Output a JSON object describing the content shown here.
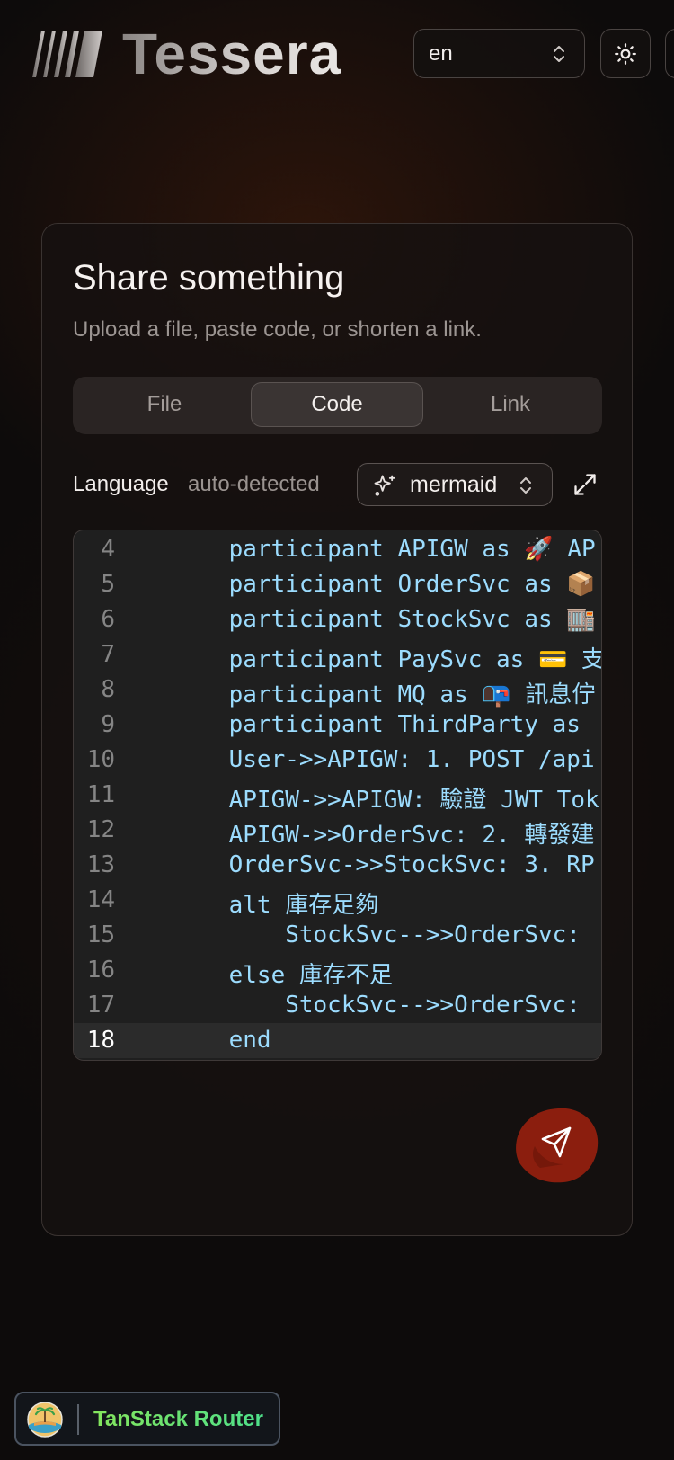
{
  "app": {
    "title": "Tessera"
  },
  "header": {
    "language_value": "en",
    "icons": {
      "logo": "striped-logo-icon",
      "theme": "sun-icon",
      "select": "chevrons-up-down-icon"
    }
  },
  "card": {
    "title": "Share something",
    "subtitle": "Upload a file, paste code, or shorten a link.",
    "tabs": [
      {
        "label": "File",
        "active": false
      },
      {
        "label": "Code",
        "active": true
      },
      {
        "label": "Link",
        "active": false
      }
    ],
    "language": {
      "label": "Language",
      "hint": "auto-detected",
      "value": "mermaid",
      "icons": {
        "detect": "sparkles-icon",
        "expand": "expand-icon"
      }
    },
    "editor": {
      "current_line": "18",
      "lines": [
        {
          "n": "4",
          "text": "    participant APIGW as 🚀 AP"
        },
        {
          "n": "5",
          "text": "    participant OrderSvc as 📦"
        },
        {
          "n": "6",
          "text": "    participant StockSvc as 🏬"
        },
        {
          "n": "7",
          "text": "    participant PaySvc as 💳 支"
        },
        {
          "n": "8",
          "text": "    participant MQ as 📭 訊息佇"
        },
        {
          "n": "9",
          "text": "    participant ThirdParty as"
        },
        {
          "n": "10",
          "text": "    User->>APIGW: 1. POST /api"
        },
        {
          "n": "11",
          "text": "    APIGW->>APIGW: 驗證 JWT Tok"
        },
        {
          "n": "12",
          "text": "    APIGW->>OrderSvc: 2. 轉發建"
        },
        {
          "n": "13",
          "text": "    OrderSvc->>StockSvc: 3. RP"
        },
        {
          "n": "14",
          "text": "    alt 庫存足夠"
        },
        {
          "n": "15",
          "text": "        StockSvc-->>OrderSvc:"
        },
        {
          "n": "16",
          "text": "    else 庫存不足"
        },
        {
          "n": "17",
          "text": "        StockSvc-->>OrderSvc:"
        },
        {
          "n": "18",
          "text": "    end"
        }
      ]
    },
    "send": {
      "icon": "send-icon",
      "color": "#8b1e0e"
    }
  },
  "devtools": {
    "label": "TanStack Router",
    "icon": "tanstack-logo-icon"
  },
  "colors": {
    "accent_send": "#8b1e0e",
    "code_text": "#9cdcfe",
    "devtools_green": "#6ee06a"
  }
}
